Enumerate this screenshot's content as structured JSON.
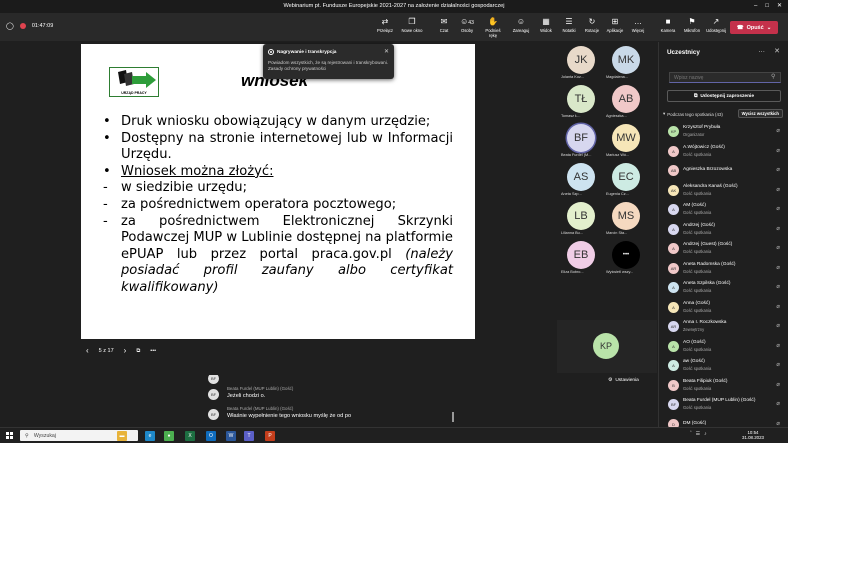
{
  "window": {
    "title": "Webinarium pt. Fundusze Europejskie 2021-2027 na założenie działalności gospodarczej"
  },
  "meeting": {
    "timer": "01:47:09"
  },
  "toolbar": {
    "items": [
      {
        "label": "Przełącz",
        "icon": "o"
      },
      {
        "label": "Nowe okno",
        "icon": "o"
      },
      {
        "label": "Czat",
        "icon": "o"
      },
      {
        "label": "Osoby",
        "icon": "o",
        "badge": "43"
      },
      {
        "label": "Podnieś rękę",
        "icon": "o"
      },
      {
        "label": "Zareaguj",
        "icon": "o"
      },
      {
        "label": "Widok",
        "icon": "o"
      },
      {
        "label": "Notatki",
        "icon": "o"
      },
      {
        "label": "Rotacje",
        "icon": "o"
      },
      {
        "label": "Aplikacje",
        "icon": "o"
      },
      {
        "label": "Więcej",
        "icon": "o"
      },
      {
        "label": "Kamera",
        "icon": "o"
      },
      {
        "label": "Mikrofon",
        "icon": "o"
      },
      {
        "label": "Udostępnij",
        "icon": "o"
      }
    ],
    "leave_label": "Opuść"
  },
  "recording_notice": {
    "title": "Nagrywanie i transkrypcja",
    "message": "Powiadom wszystkich, że są rejestrowani i transkrybowani. Zasady ochrony prywatności"
  },
  "slide": {
    "logo_text": "URZĄD PRACY",
    "title": "wniosek",
    "items": [
      {
        "mark": "•",
        "text": "Druk wniosku obowiązujący w danym urzędzie;"
      },
      {
        "mark": "•",
        "text": "Dostępny na stronie internetowej lub w Informacji Urzędu."
      },
      {
        "mark": "•",
        "text": "Wniosek można złożyć:"
      },
      {
        "mark": "-",
        "text": "w siedzibie urzędu;"
      },
      {
        "mark": "-",
        "text": "za pośrednictwem operatora pocztowego;"
      },
      {
        "mark": "-",
        "text": "za pośrednictwem Elektronicznej Skrzynki Podawczej MUP w Lublinie dostępnej na platformie ePUAP lub przez portal praca.gov.pl ",
        "italic": "(należy posiadać profil zaufany albo certyfikat kwalifikowany)"
      }
    ],
    "page_indicator": "5 z 17"
  },
  "gallery": [
    {
      "initials": "JK",
      "name": "Jolanta Koz...",
      "color": "#e8d9c9"
    },
    {
      "initials": "MK",
      "name": "Magdalena...",
      "color": "#c9d9e8"
    },
    {
      "initials": "TŁ",
      "name": "Tomasz Ł...",
      "color": "#d9e8c9"
    },
    {
      "initials": "AB",
      "name": "Agnieszka...",
      "color": "#f0c8c8"
    },
    {
      "initials": "BF",
      "name": "Beata Furdel (M...",
      "color": "#d7d7ef",
      "active": true
    },
    {
      "initials": "MW",
      "name": "Mariusz Wó...",
      "color": "#f6e6b8"
    },
    {
      "initials": "AS",
      "name": "Aneta Szp...",
      "color": "#cde3f0"
    },
    {
      "initials": "EC",
      "name": "Eugenia Cz...",
      "color": "#cdebe3"
    },
    {
      "initials": "LB",
      "name": "Lilianna Bu...",
      "color": "#e3f0cd"
    },
    {
      "initials": "MS",
      "name": "Marcin Sta...",
      "color": "#f5d9c0"
    },
    {
      "initials": "EB",
      "name": "Eliza Bobro...",
      "color": "#f0cde6"
    },
    {
      "initials": "•••",
      "name": "Wyświetl wszy...",
      "color": "#000000",
      "dark": true
    }
  ],
  "self_view": {
    "initials": "KP"
  },
  "participants_panel": {
    "title": "Uczestnicy",
    "search_placeholder": "Wpisz nazwę",
    "share_label": "Udostępnij zaproszenie",
    "section_label": "Podczas tego spotkania (43)",
    "admit_label": "Wycisz wszystkich",
    "people": [
      {
        "initials": "KP",
        "name": "Krzysztof Prybuła",
        "role": "Organizator",
        "color": "#b9e3a9"
      },
      {
        "initials": "A",
        "name": "A.Wójtowicz (Gość)",
        "role": "Gość spotkania",
        "color": "#f0c8c8"
      },
      {
        "initials": "AB",
        "name": "Agnieszka Brzozowska",
        "role": "",
        "color": "#f0c8c8"
      },
      {
        "initials": "AK",
        "name": "Aleksandra Kanaś (Gość)",
        "role": "Gość spotkania",
        "color": "#f6e6b8"
      },
      {
        "initials": "A",
        "name": "AM (Gość)",
        "role": "Gość spotkania",
        "color": "#d7d7ef"
      },
      {
        "initials": "A",
        "name": "Andrzej (Gość)",
        "role": "Gość spotkania",
        "color": "#d7d7ef"
      },
      {
        "initials": "A",
        "name": "Andrzej (Guest) (Gość)",
        "role": "Gość spotkania",
        "color": "#f0c8c8"
      },
      {
        "initials": "AR",
        "name": "Aneta Radomska (Gość)",
        "role": "Gość spotkania",
        "color": "#f0c8c8"
      },
      {
        "initials": "A",
        "name": "Aneta Szpilska (Gość)",
        "role": "Gość spotkania",
        "color": "#cde3f0"
      },
      {
        "initials": "A",
        "name": "Anna (Gość)",
        "role": "Gość spotkania",
        "color": "#f6e6b8"
      },
      {
        "initials": "AR",
        "name": "Anna I. Roczkowska",
        "role": "Zewnętrzny",
        "color": "#d7d7ef"
      },
      {
        "initials": "A",
        "name": "AO (Gość)",
        "role": "Gość spotkania",
        "color": "#b9e3a9"
      },
      {
        "initials": "A",
        "name": "aw (Gość)",
        "role": "Gość spotkania",
        "color": "#cdebe3"
      },
      {
        "initials": "B",
        "name": "Beata Filipiuk (Gość)",
        "role": "Gość spotkania",
        "color": "#f0c8c8"
      },
      {
        "initials": "BF",
        "name": "Beata Furdel (MUP Lublin) (Gość)",
        "role": "Gość spotkania",
        "color": "#d7d7ef"
      },
      {
        "initials": "D",
        "name": "DM (Gość)",
        "role": "",
        "color": "#f0c8c8"
      }
    ]
  },
  "captions": {
    "settings_label": "Ustawienia",
    "lines": [
      {
        "initials": "BF",
        "speaker": "",
        "text": "Jeżeli chodzi o."
      },
      {
        "initials": "BF",
        "speaker": "Beata Furdel (MUP Lublin) (Gość)",
        "text": "Jeżeli chodzi o."
      },
      {
        "initials": "BF",
        "speaker": "Beata Furdel (MUP Lublin) (Gość)",
        "text": "Właśnie wypełnienie tego wniosku myślę że od po"
      }
    ]
  },
  "taskbar": {
    "search_placeholder": "Wyszukaj",
    "time": "10:54",
    "date": "31.08.2023",
    "apps": [
      {
        "name": "file-explorer-icon",
        "color": "#e8b33a",
        "glyph": "▬"
      },
      {
        "name": "edge-icon",
        "color": "#1e88c8",
        "glyph": "e"
      },
      {
        "name": "chrome-icon",
        "color": "#4caf50",
        "glyph": "●"
      },
      {
        "name": "excel-icon",
        "color": "#1d6f42",
        "glyph": "X"
      },
      {
        "name": "outlook-icon",
        "color": "#0f6cbd",
        "glyph": "O"
      },
      {
        "name": "word-icon",
        "color": "#2b579a",
        "glyph": "W"
      },
      {
        "name": "teams-icon",
        "color": "#5b5fc7",
        "glyph": "T"
      },
      {
        "name": "powerpoint-icon",
        "color": "#c43e1c",
        "glyph": "P"
      }
    ]
  }
}
